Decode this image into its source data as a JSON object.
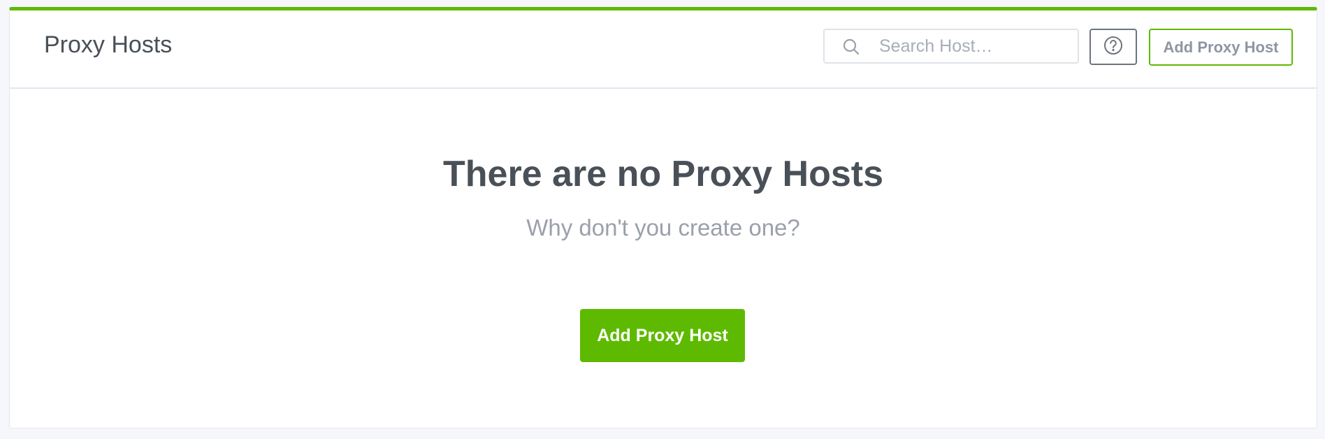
{
  "header": {
    "title": "Proxy Hosts",
    "search": {
      "placeholder": "Search Host…",
      "value": ""
    },
    "help_icon": "help-circle-icon",
    "search_icon": "search-icon",
    "add_button_label": "Add Proxy Host"
  },
  "empty_state": {
    "title": "There are no Proxy Hosts",
    "subtitle": "Why don't you create one?",
    "add_button_label": "Add Proxy Host"
  },
  "colors": {
    "accent": "#5eba00",
    "text": "#495057",
    "muted": "#9aa0ac",
    "background": "#f5f7fb"
  }
}
